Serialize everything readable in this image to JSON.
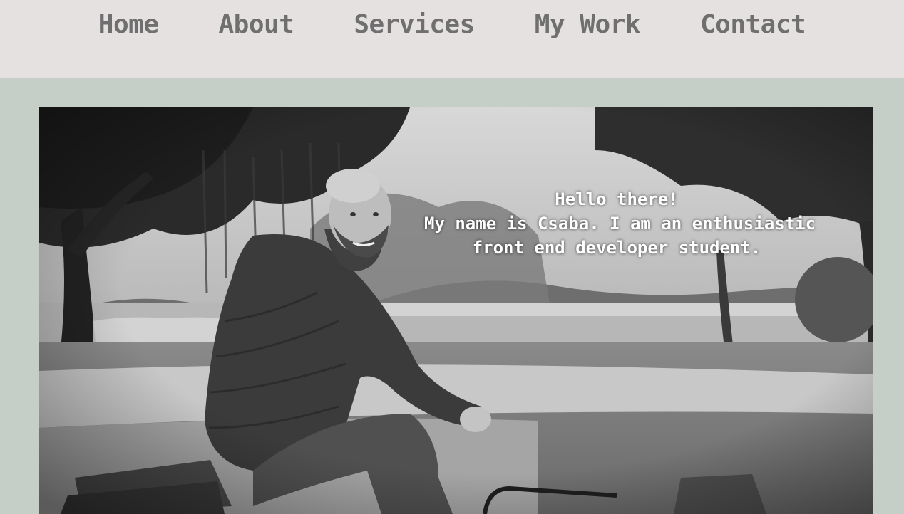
{
  "nav": {
    "links": [
      {
        "label": "Home"
      },
      {
        "label": "About"
      },
      {
        "label": "Services"
      },
      {
        "label": "My Work"
      },
      {
        "label": "Contact"
      }
    ]
  },
  "hero": {
    "greeting": "Hello there!",
    "intro_line1": "My name is Csaba. I am an enthusiastic",
    "intro_line2": "front end developer student."
  },
  "colors": {
    "page_background": "#c6cec8",
    "nav_background": "#e5e1e0",
    "nav_text": "#6f6f6f",
    "hero_text": "#ffffff"
  }
}
